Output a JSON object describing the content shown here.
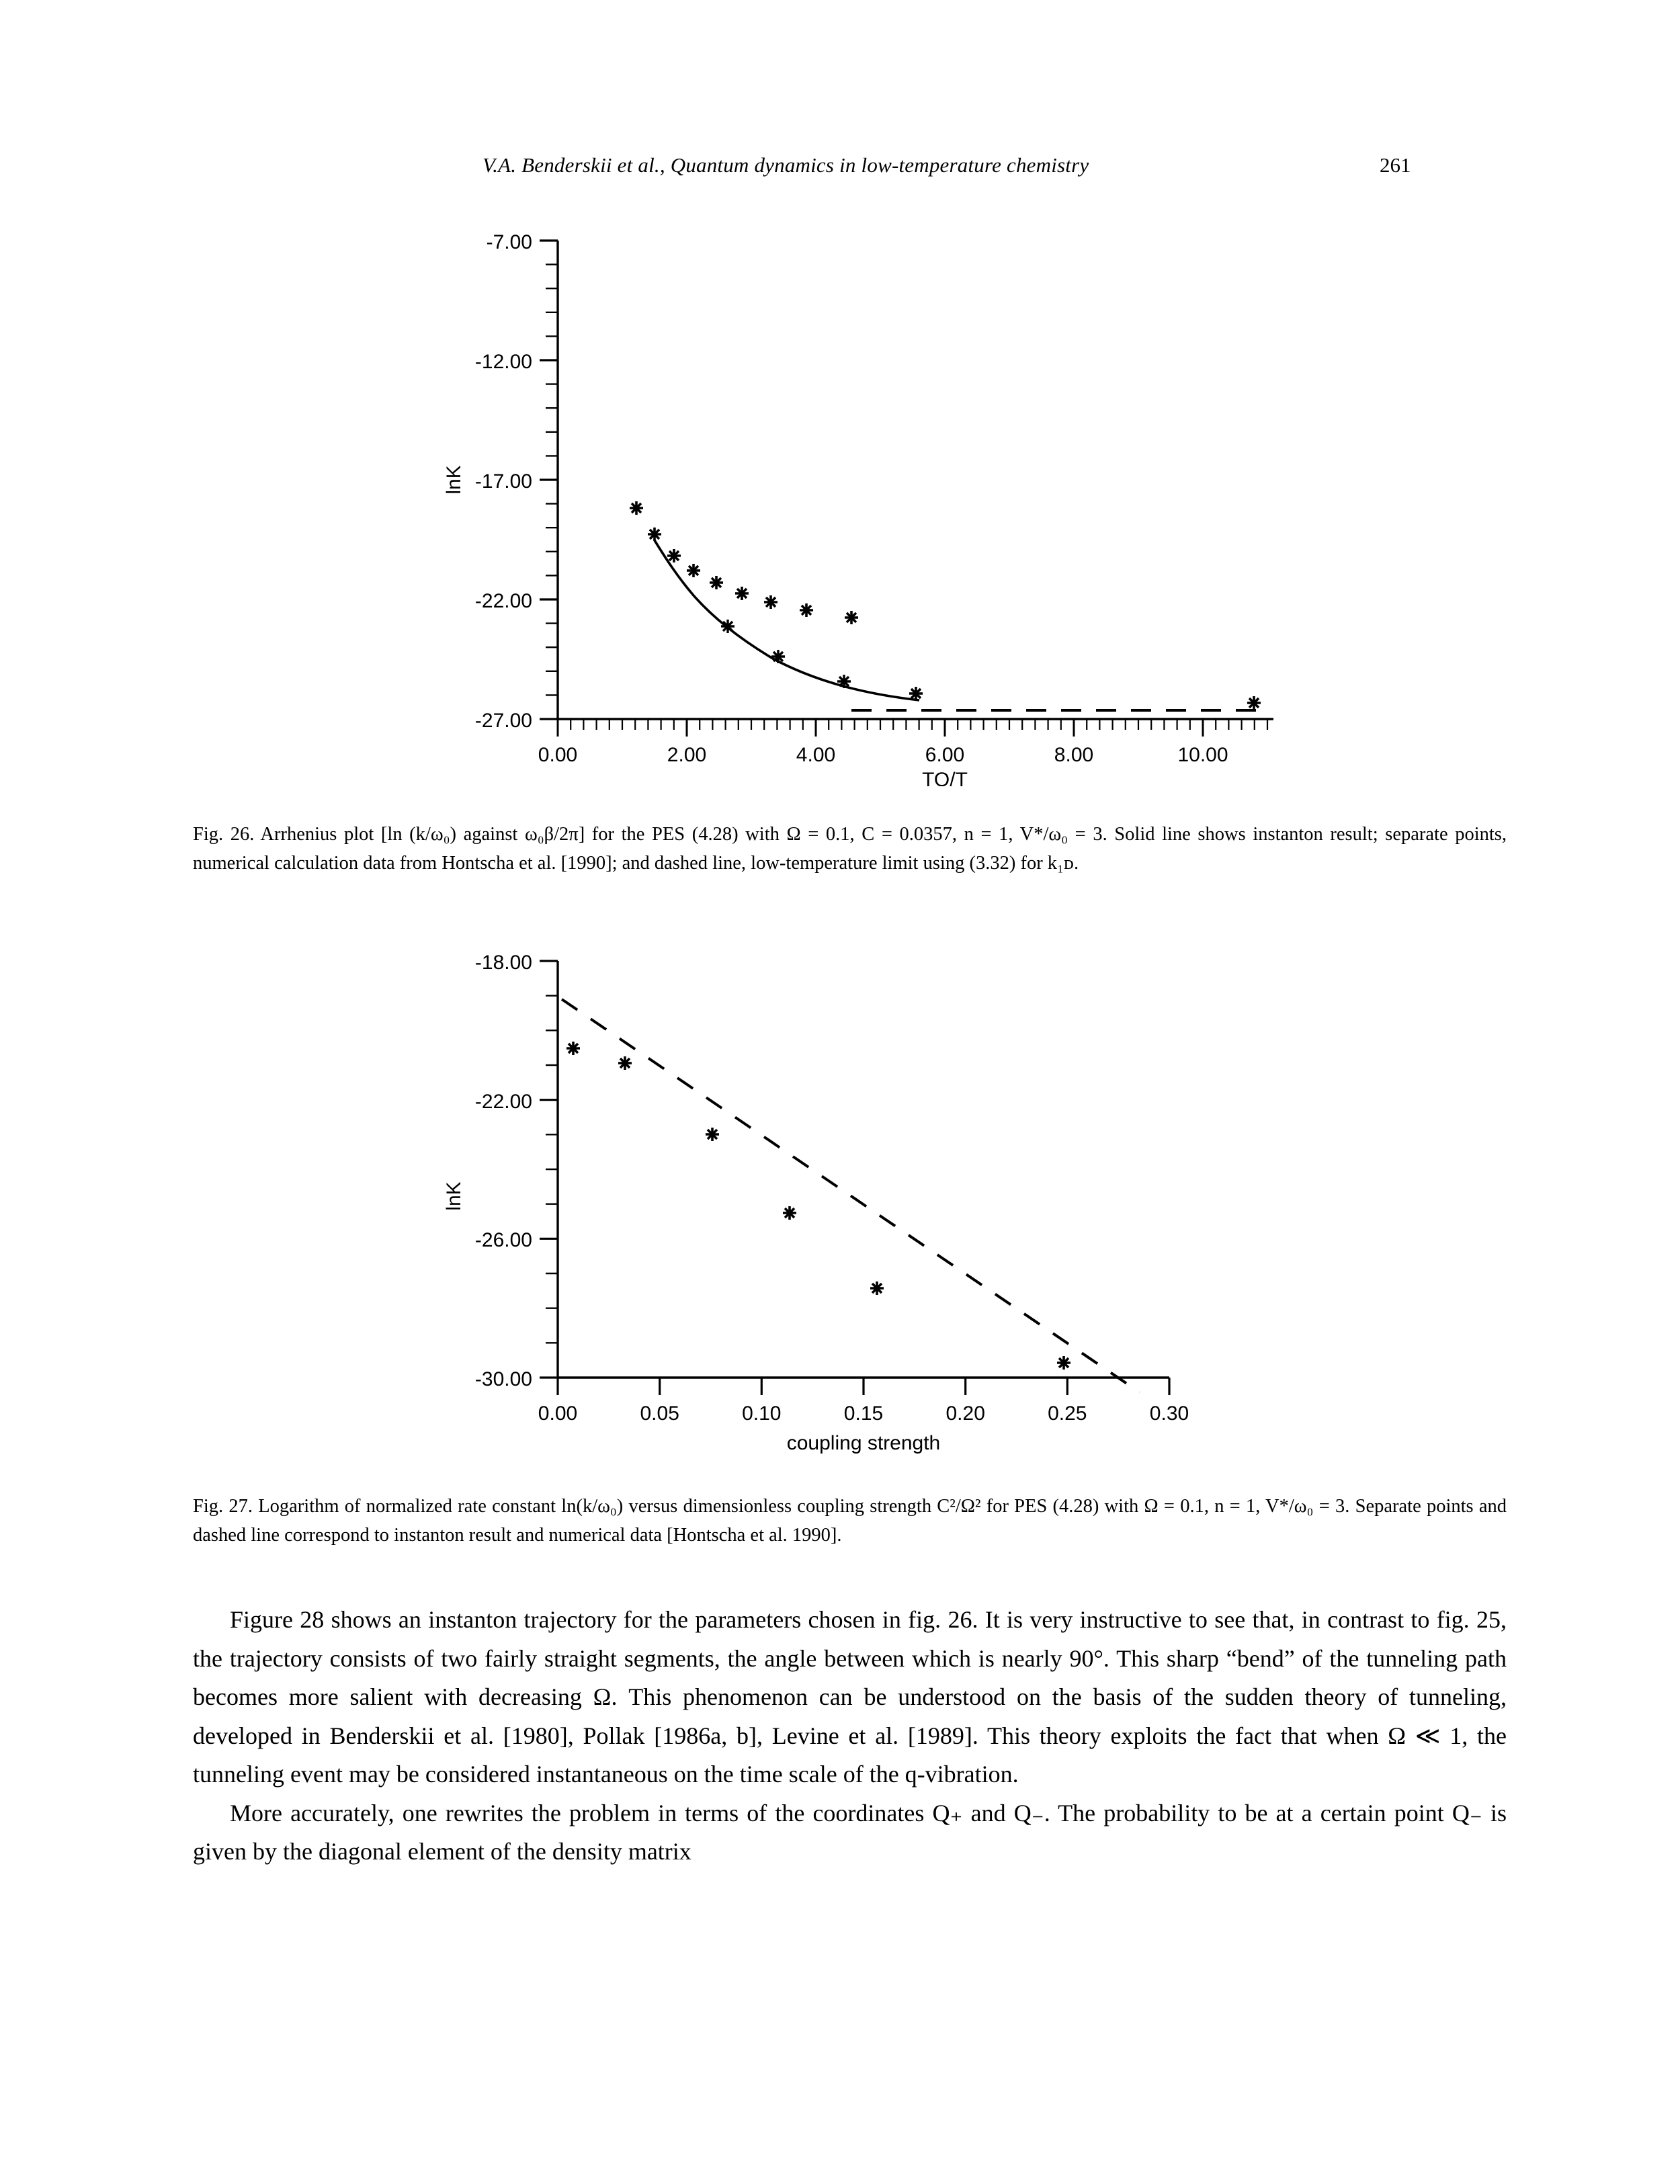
{
  "running_head": {
    "title": "V.A. Benderskii et al., Quantum dynamics in low-temperature chemistry",
    "page_number": "261"
  },
  "figure26": {
    "caption_label": "Fig. 26.",
    "caption_line1": "Arrhenius plot [ln (k/ω₀) against ω₀β/2π] for the PES (4.28) with Ω = 0.1, C = 0.0357, n = 1, V*/ω₀ = 3. Solid line shows",
    "caption_line2": "instanton result; separate points, numerical calculation data from Hontscha et al. [1990]; and dashed line, low-temperature limit using",
    "caption_line3": "(3.32) for k₁ᴅ.",
    "xlabel": "TO/T",
    "ylabel": "lnK",
    "xticks": [
      "0.00",
      "2.00",
      "4.00",
      "6.00",
      "8.00",
      "10.00"
    ],
    "yticks": [
      "-7.00",
      "-12.00",
      "-17.00",
      "-22.00",
      "-27.00"
    ]
  },
  "figure27": {
    "caption_label": "Fig. 27.",
    "caption_line1": "Logarithm of normalized rate constant ln(k/ω₀) versus dimensionless coupling strength C²/Ω² for PES (4.28) with Ω = 0.1,",
    "caption_line2": "n = 1, V*/ω₀ = 3. Separate points and dashed line correspond to instanton result and numerical data [Hontscha et al. 1990].",
    "xlabel": "coupling  strength",
    "ylabel": "lnK",
    "xticks": [
      "0.00",
      "0.05",
      "0.10",
      "0.15",
      "0.20",
      "0.25",
      "0.30"
    ],
    "yticks": [
      "-18.00",
      "-22.00",
      "-26.00",
      "-30.00"
    ]
  },
  "body": {
    "para1_line1": "Figure 28 shows an instanton trajectory for the parameters chosen in fig. 26. It is very instructive",
    "para1_line2": "to see that, in contrast to fig. 25, the trajectory consists of two fairly straight segments, the angle",
    "para1_line3": "between which is nearly 90°. This sharp “bend” of the tunneling path becomes more salient with",
    "para1_line4": "decreasing Ω. This phenomenon can be understood on the basis of the sudden theory of tunneling,",
    "para1_line5": "developed in Benderskii et al. [1980], Pollak [1986a, b], Levine et al. [1989]. This theory exploits",
    "para1_line6": "the fact that when Ω ≪ 1, the tunneling event may be considered instantaneous on the time scale of",
    "para1_line7": "the q-vibration.",
    "para2_line1": "More  accurately,  one  rewrites  the  problem  in  terms  of  the  coordinates  Q₊  and  Q₋.  The",
    "para2_line2": "probability to be at a certain point Q₋ is given by the diagonal element of the density matrix"
  },
  "chart_data": [
    {
      "type": "line",
      "title": "Fig. 26 Arrhenius plot",
      "xlabel": "TO/T",
      "ylabel": "lnK",
      "xlim": [
        0.0,
        11.3
      ],
      "ylim": [
        -27.0,
        -7.0
      ],
      "xticks": [
        0.0,
        2.0,
        4.0,
        6.0,
        8.0,
        10.0
      ],
      "yticks": [
        -27.0,
        -22.0,
        -17.0,
        -12.0,
        -7.0
      ],
      "grid": false,
      "legend": null,
      "series": [
        {
          "name": "numerical data (Hontscha et al. 1990)",
          "style": "points",
          "marker": "star",
          "x": [
            1.22,
            1.5,
            1.8,
            2.1,
            2.45,
            2.85,
            3.3,
            3.85,
            4.55,
            5.55,
            10.8
          ],
          "y": [
            -18.95,
            -20.05,
            -20.95,
            -21.55,
            -22.05,
            -22.5,
            -22.85,
            -23.2,
            -23.5,
            -23.85,
            -24.4
          ]
        },
        {
          "name": "instanton result (solid line)",
          "style": "solid-line",
          "x": [
            1.5,
            1.8,
            2.1,
            2.45,
            2.85,
            3.3,
            3.85,
            4.55,
            5.55,
            6.4
          ],
          "y": [
            -20.05,
            -20.95,
            -21.55,
            -22.05,
            -22.5,
            -22.85,
            -23.2,
            -23.5,
            -23.85,
            -24.0
          ]
        },
        {
          "name": "low-temperature limit (dashed line)",
          "style": "dashed-line",
          "x": [
            4.55,
            10.9
          ],
          "y": [
            -24.42,
            -24.42
          ]
        }
      ]
    },
    {
      "type": "scatter",
      "title": "Fig. 27 ln(k/w0) vs coupling strength",
      "xlabel": "coupling  strength",
      "ylabel": "lnK",
      "xlim": [
        0.0,
        0.3
      ],
      "ylim": [
        -30.0,
        -18.0
      ],
      "xticks": [
        0.0,
        0.05,
        0.1,
        0.15,
        0.2,
        0.25,
        0.3
      ],
      "yticks": [
        -30.0,
        -26.0,
        -22.0,
        -18.0
      ],
      "grid": false,
      "legend": null,
      "series": [
        {
          "name": "instanton result (points)",
          "style": "points",
          "marker": "star",
          "x": [
            0.008,
            0.032,
            0.077,
            0.115,
            0.158
          ],
          "y": [
            -20.52,
            -20.95,
            -23.0,
            -25.28,
            -27.45
          ]
        },
        {
          "name": "numerical data (dashed line)",
          "style": "dashed-line",
          "x": [
            0.0,
            0.3
          ],
          "y": [
            -19.1,
            -31.7
          ]
        },
        {
          "name": "dashed-line point",
          "style": "points",
          "marker": "star",
          "x": [
            0.248
          ],
          "y": [
            -29.8
          ]
        }
      ]
    }
  ]
}
